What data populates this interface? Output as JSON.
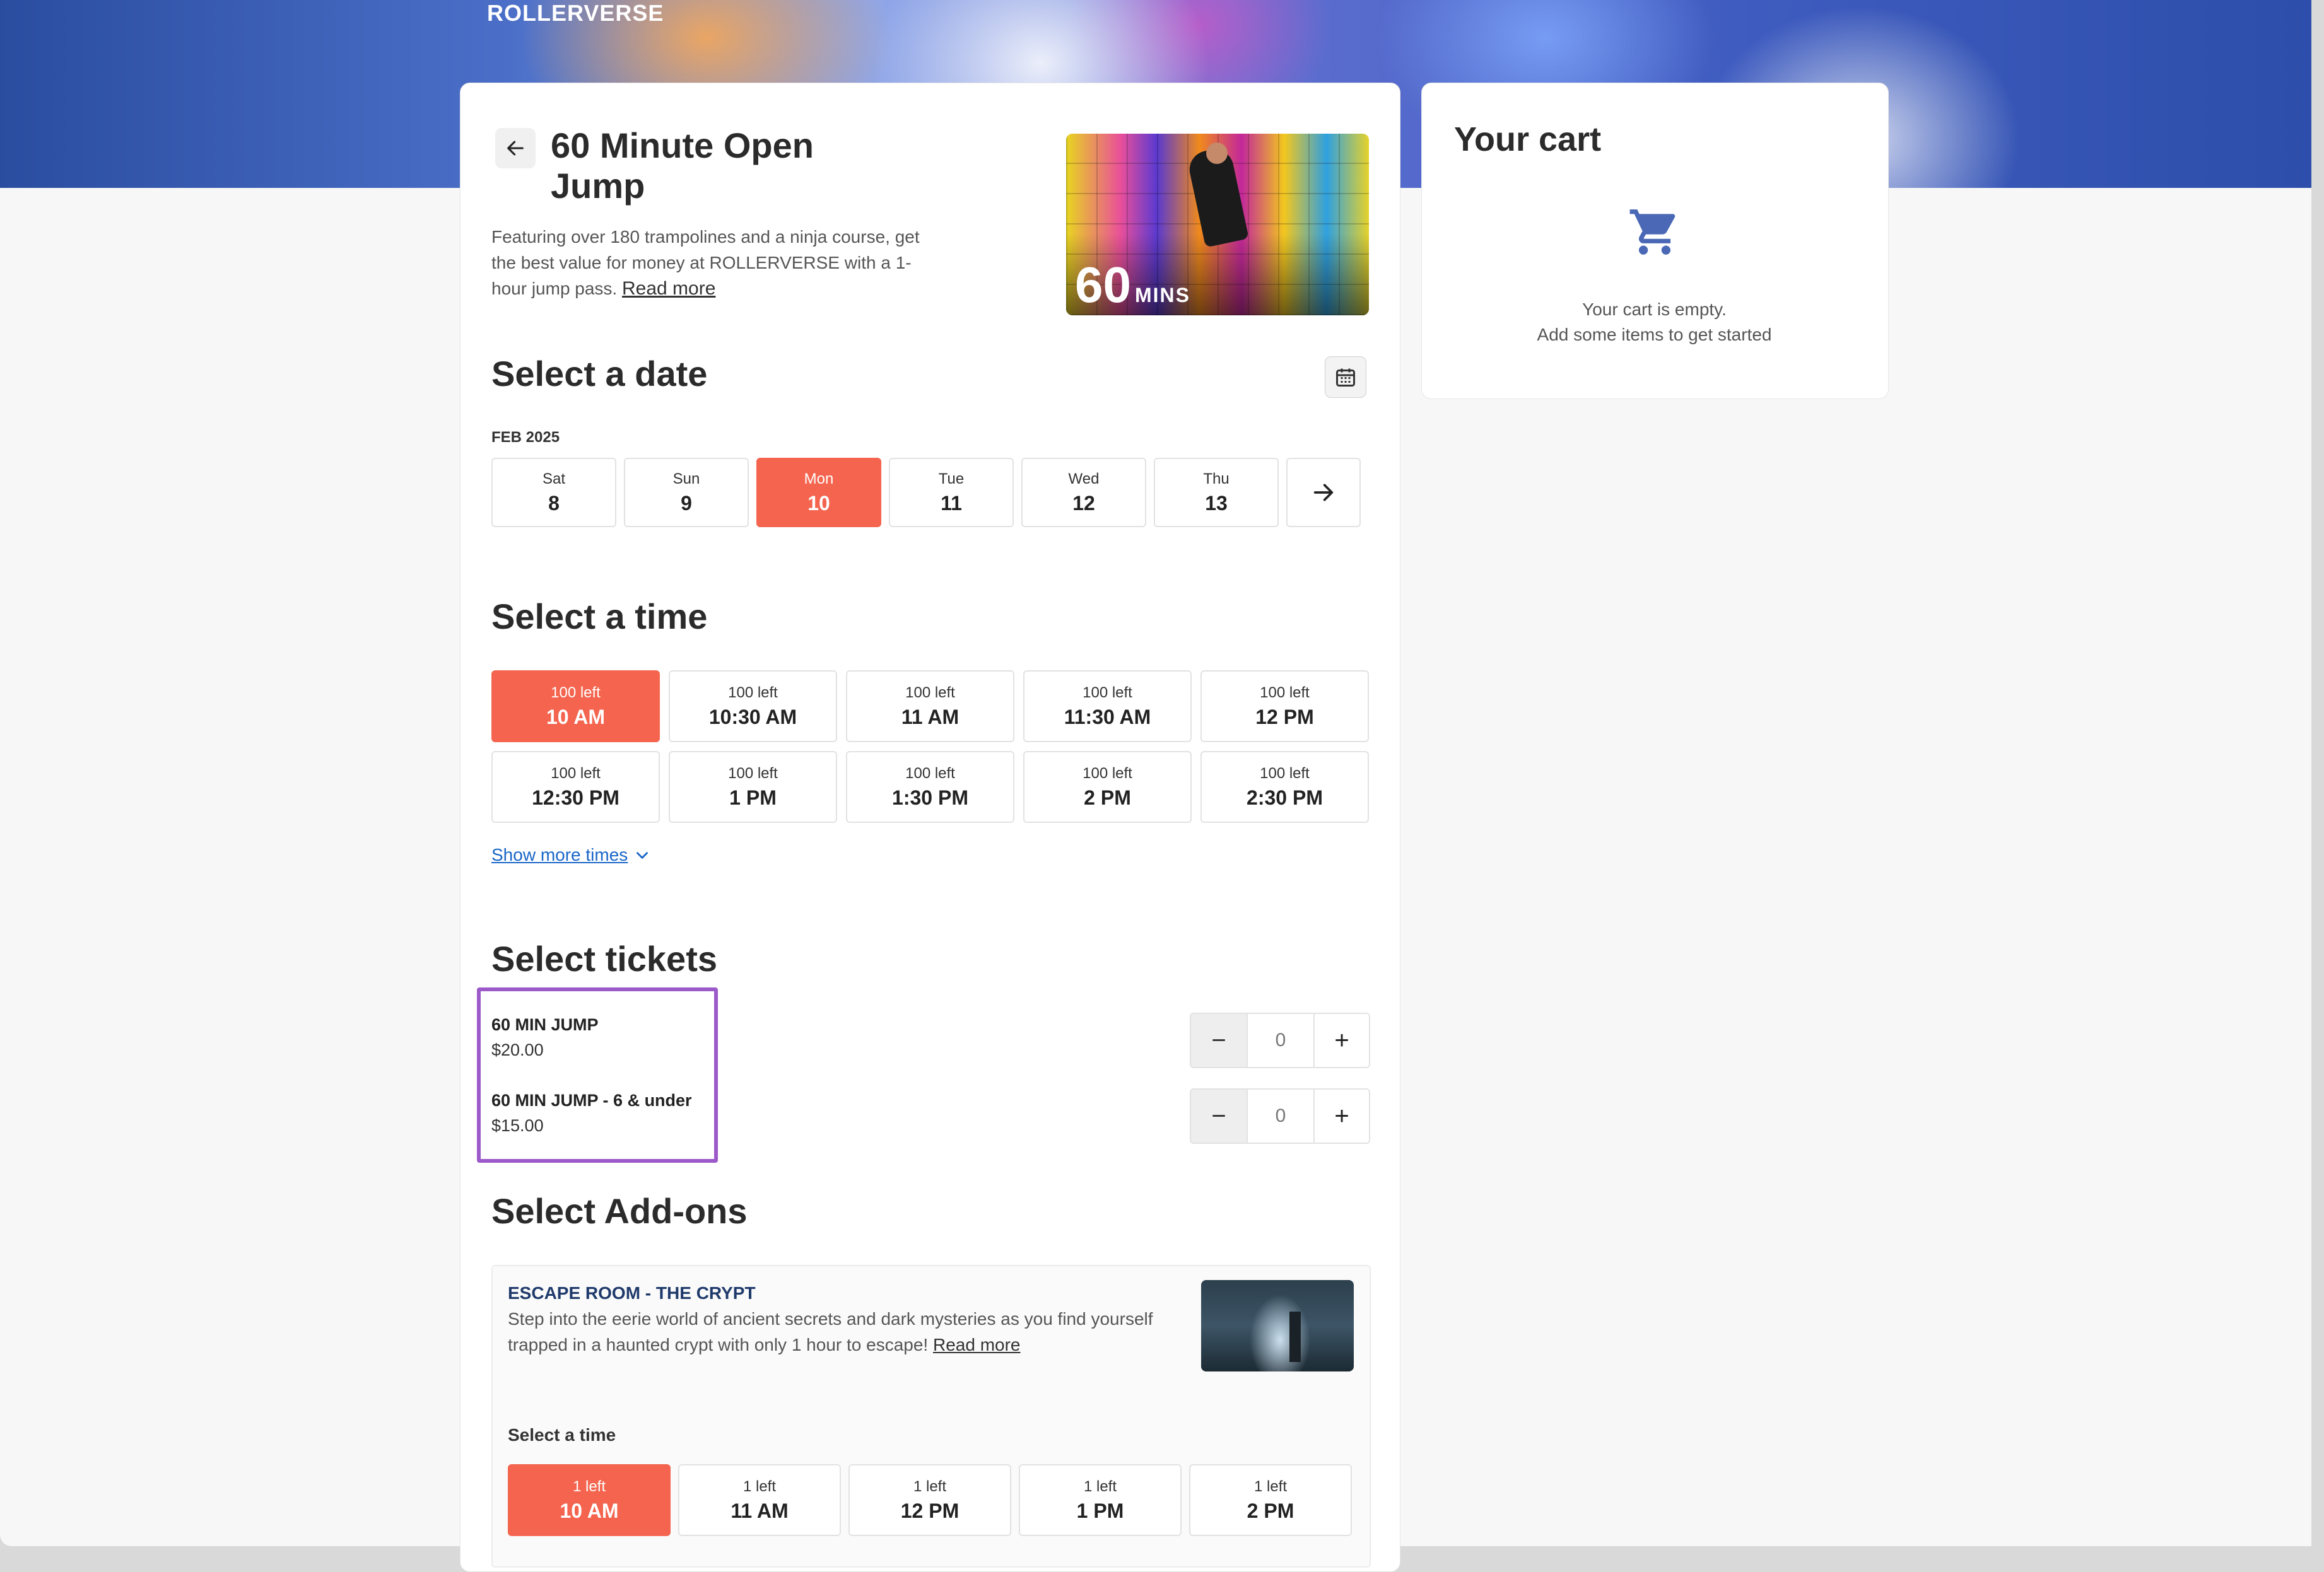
{
  "brand": "ROLLERVERSE",
  "product": {
    "title": "60 Minute Open Jump",
    "description": "Featuring over 180 trampolines and a ninja course, get the best value for money at ROLLERVERSE with a 1-hour jump pass.",
    "read_more": "Read more",
    "image_badge_number": "60",
    "image_badge_unit": "MINS"
  },
  "date_section": {
    "title": "Select a date",
    "month": "FEB 2025",
    "dates": [
      {
        "dow": "Sat",
        "day": "8"
      },
      {
        "dow": "Sun",
        "day": "9"
      },
      {
        "dow": "Mon",
        "day": "10"
      },
      {
        "dow": "Tue",
        "day": "11"
      },
      {
        "dow": "Wed",
        "day": "12"
      },
      {
        "dow": "Thu",
        "day": "13"
      }
    ],
    "selected_index": 2
  },
  "time_section": {
    "title": "Select a time",
    "times": [
      {
        "left": "100 left",
        "time": "10 AM"
      },
      {
        "left": "100 left",
        "time": "10:30 AM"
      },
      {
        "left": "100 left",
        "time": "11 AM"
      },
      {
        "left": "100 left",
        "time": "11:30 AM"
      },
      {
        "left": "100 left",
        "time": "12 PM"
      },
      {
        "left": "100 left",
        "time": "12:30 PM"
      },
      {
        "left": "100 left",
        "time": "1 PM"
      },
      {
        "left": "100 left",
        "time": "1:30 PM"
      },
      {
        "left": "100 left",
        "time": "2 PM"
      },
      {
        "left": "100 left",
        "time": "2:30 PM"
      }
    ],
    "selected_index": 0,
    "show_more": "Show more times"
  },
  "tickets_section": {
    "title": "Select tickets",
    "tickets": [
      {
        "name": "60 MIN JUMP",
        "price": "$20.00",
        "quantity": "0"
      },
      {
        "name": "60 MIN JUMP - 6 & under",
        "price": "$15.00",
        "quantity": "0"
      }
    ]
  },
  "addons_section": {
    "title": "Select Add-ons",
    "addon": {
      "name": "ESCAPE ROOM - THE CRYPT",
      "description": "Step into the eerie world of ancient secrets and dark mysteries as you find yourself trapped in a haunted crypt with only 1 hour to escape!",
      "read_more": "Read more",
      "select_time_label": "Select a time",
      "times": [
        {
          "left": "1 left",
          "time": "10 AM"
        },
        {
          "left": "1 left",
          "time": "11 AM"
        },
        {
          "left": "1 left",
          "time": "12 PM"
        },
        {
          "left": "1 left",
          "time": "1 PM"
        },
        {
          "left": "1 left",
          "time": "2 PM"
        }
      ],
      "selected_index": 0
    }
  },
  "cart": {
    "title": "Your cart",
    "empty_line1": "Your cart is empty.",
    "empty_line2": "Add some items to get started",
    "icon": "cart-icon"
  },
  "colors": {
    "accent": "#f4644e",
    "link": "#1a66c8",
    "highlight_box": "#9b59c9",
    "cart_icon": "#4a68b5"
  }
}
